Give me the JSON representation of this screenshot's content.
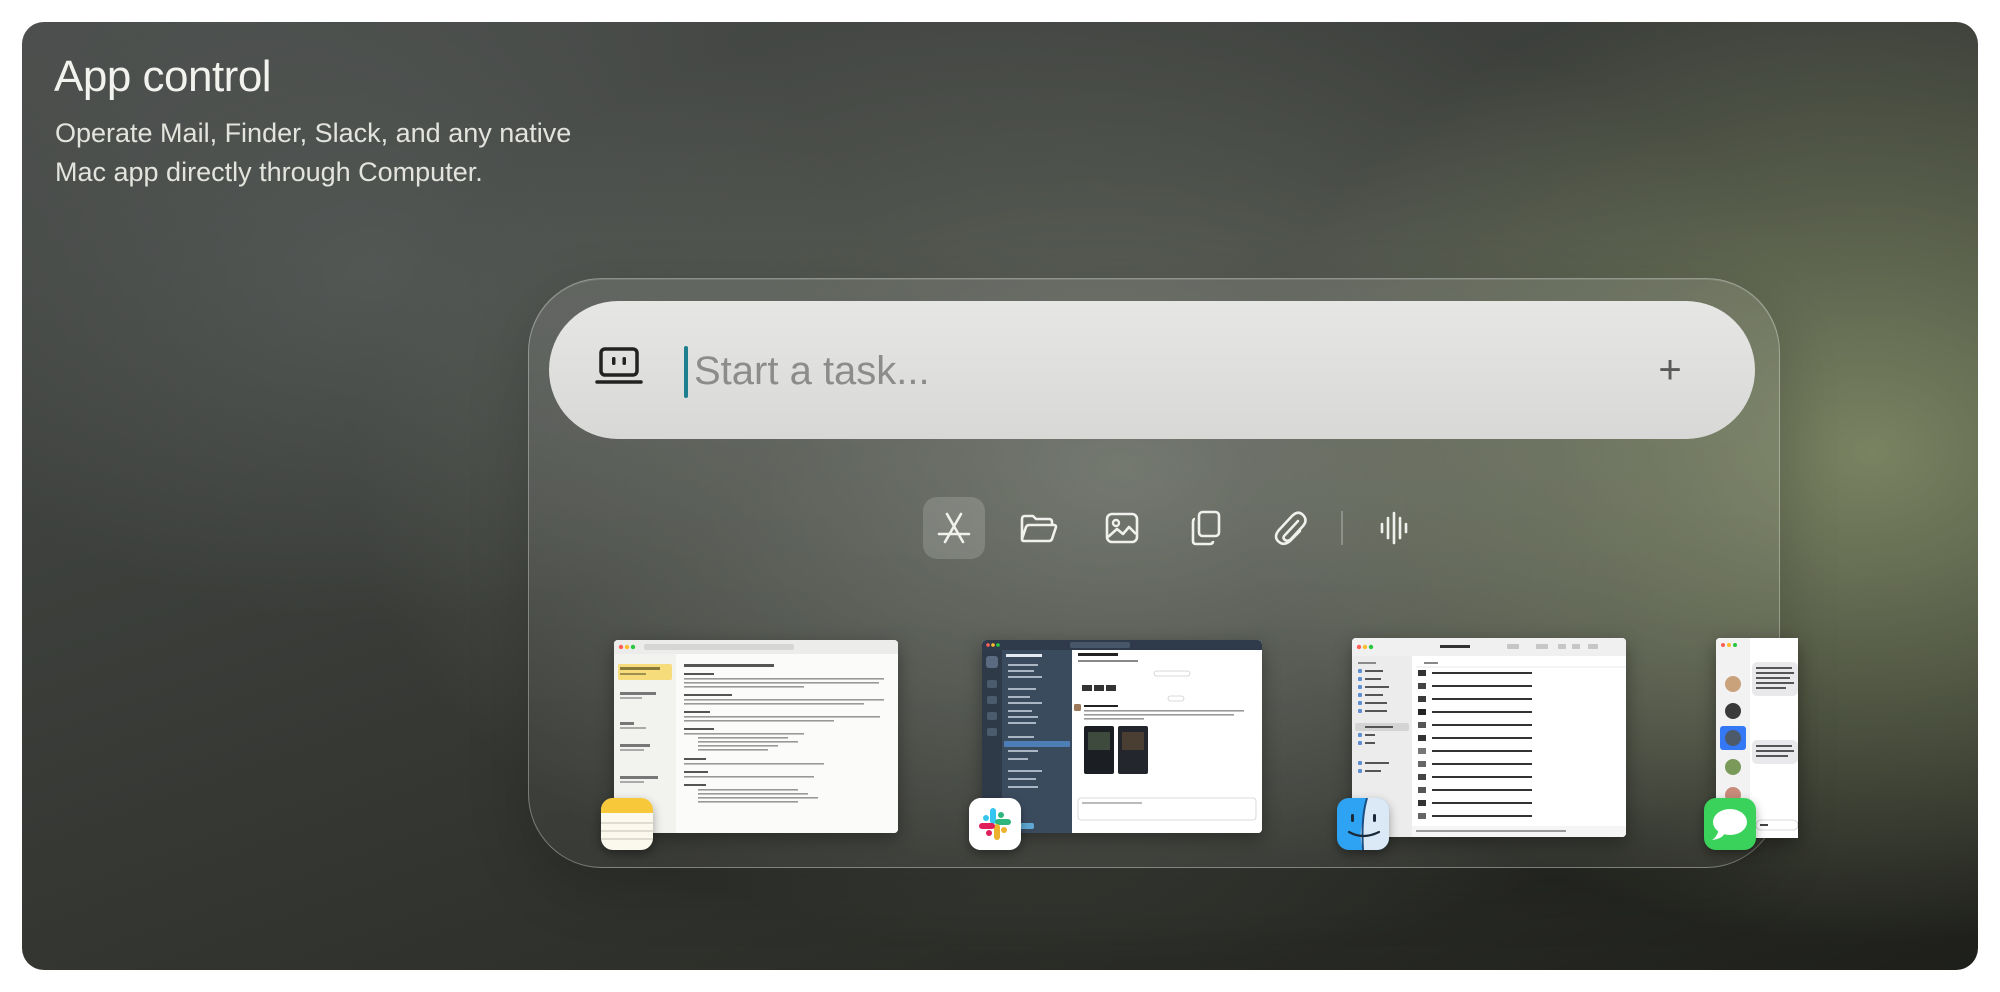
{
  "header": {
    "title": "App control",
    "subtitle_line1": "Operate Mail, Finder, Slack, and any native",
    "subtitle_line2": "Mac app directly through Computer."
  },
  "task_bar": {
    "placeholder": "Start a task...",
    "value": "",
    "computer_icon": "computer-icon",
    "add_icon": "plus-icon",
    "add_label": "+"
  },
  "toolbar": {
    "items": [
      {
        "name": "app-store",
        "icon": "app-store-icon",
        "active": true
      },
      {
        "name": "folder",
        "icon": "folder-icon",
        "active": false
      },
      {
        "name": "image",
        "icon": "image-icon",
        "active": false
      },
      {
        "name": "copy",
        "icon": "copy-icon",
        "active": false
      },
      {
        "name": "attach",
        "icon": "paperclip-icon",
        "active": false
      },
      {
        "name": "voice",
        "icon": "waveform-icon",
        "active": false
      }
    ]
  },
  "windows": [
    {
      "app": "Notes",
      "icon": "notes-icon",
      "title": "Kitchen Remodel Plan – Draft",
      "list_items": [
        "Kitchen Remodel Pla...",
        "Concrete contractor",
        "Grill",
        "AST Documents",
        "Lase Dome - painter"
      ]
    },
    {
      "app": "Slack",
      "icon": "slack-icon",
      "workspace": "Perplexity",
      "channel": "# design-gal",
      "message_author": "Sebastian Spiller",
      "date_divider": "Today"
    },
    {
      "app": "Finder",
      "icon": "finder-icon",
      "folder": "Screenshots",
      "sidebar": [
        "AirDrop",
        "Recents",
        "Applications",
        "Desktop",
        "Documents",
        "Downloads",
        "Screenshots",
        "Dev",
        "MCP",
        "macOS",
        "iCloud Drive",
        "Shared"
      ],
      "files": [
        "Screenshot 2025-08-14 at 1.38.50 PM",
        "Screenshot 2025-08-13 at 6.03.23 PM",
        "Screenshot 2025-08-13 at 6.02.29 PM",
        "Screenshot 2025-08-13 at 6.01.55 PM",
        "Screenshot 2025-08-13 at 6.01.48 PM",
        "Screenshot 2025-08-13 at 5.41.35 PM",
        "Screenshot 2025-08-13 at 5.41.18 PM",
        "Screenshot 2025-08-13 at 5.29.53 PM",
        "Screenshot 2025-08-13 at 5.29.11 PM",
        "Screenshot 2025-08-13 at 5.28.55 PM",
        "Screenshot 2025-08-13 at 5.28.34 PM",
        "Screenshot 2025-08-13 at 5.09.16 PM"
      ]
    },
    {
      "app": "Messages",
      "icon": "messages-icon",
      "to": "To: JoJo Ron",
      "bubbles": [
        "Hey love! W come over t projects an dinner. Feel Sal are arou",
        "Hey we're s couple roac we can do a"
      ],
      "reply": "Hey"
    }
  ],
  "colors": {
    "accent_cursor": "#1d7f8f",
    "card_dark": "#1e1f1b",
    "card_olive": "#7d8764",
    "taskbar_bg": "#e0e0de"
  }
}
